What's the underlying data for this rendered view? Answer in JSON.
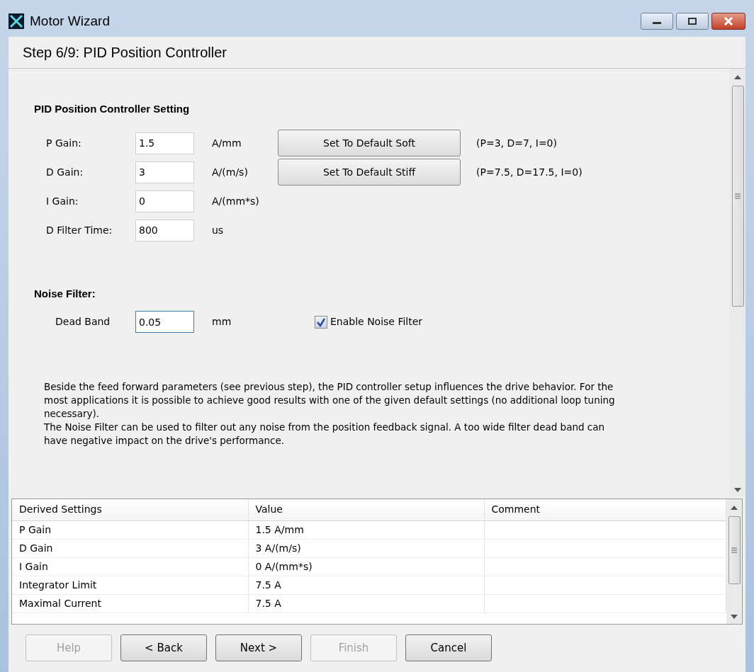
{
  "window": {
    "title": "Motor Wizard"
  },
  "step_title": "Step 6/9: PID Position Controller",
  "pid_section": {
    "title": "PID Position Controller Setting",
    "rows": [
      {
        "label": "P Gain:",
        "value": "1.5",
        "unit": "A/mm",
        "button": "Set To Default Soft",
        "hint": "(P=3, D=7, I=0)"
      },
      {
        "label": "D Gain:",
        "value": "3",
        "unit": "A/(m/s)",
        "button": "Set To Default Stiff",
        "hint": "(P=7.5, D=17.5, I=0)"
      },
      {
        "label": "I Gain:",
        "value": "0",
        "unit": "A/(mm*s)"
      },
      {
        "label": "D Filter Time:",
        "value": "800",
        "unit": "us"
      }
    ]
  },
  "noise_section": {
    "title": "Noise Filter:",
    "dead_band": {
      "label": "Dead Band",
      "value": "0.05",
      "unit": "mm"
    },
    "enable": {
      "label": "Enable Noise Filter",
      "checked": true
    }
  },
  "description": [
    "Beside the feed forward parameters (see previous step), the PID controller setup influences the drive behavior. For the most applications it is possible to achieve good results with one of the given default settings (no additional loop tuning necessary).",
    "The Noise Filter can be used to filter out any noise from the position feedback signal. A too wide filter dead band can have negative impact on the drive's performance."
  ],
  "table": {
    "columns": [
      "Derived Settings",
      "Value",
      "Comment"
    ],
    "rows": [
      [
        "P Gain",
        "1.5 A/mm",
        ""
      ],
      [
        "D Gain",
        "3 A/(m/s)",
        ""
      ],
      [
        "I Gain",
        "0 A/(mm*s)",
        ""
      ],
      [
        "Integrator Limit",
        "7.5 A",
        ""
      ],
      [
        "Maximal Current",
        "7.5 A",
        ""
      ]
    ]
  },
  "buttons": [
    {
      "label": "Help",
      "disabled": true
    },
    {
      "label": "< Back",
      "disabled": false
    },
    {
      "label": "Next >",
      "disabled": false
    },
    {
      "label": "Finish",
      "disabled": true
    },
    {
      "label": "Cancel",
      "disabled": false
    }
  ]
}
